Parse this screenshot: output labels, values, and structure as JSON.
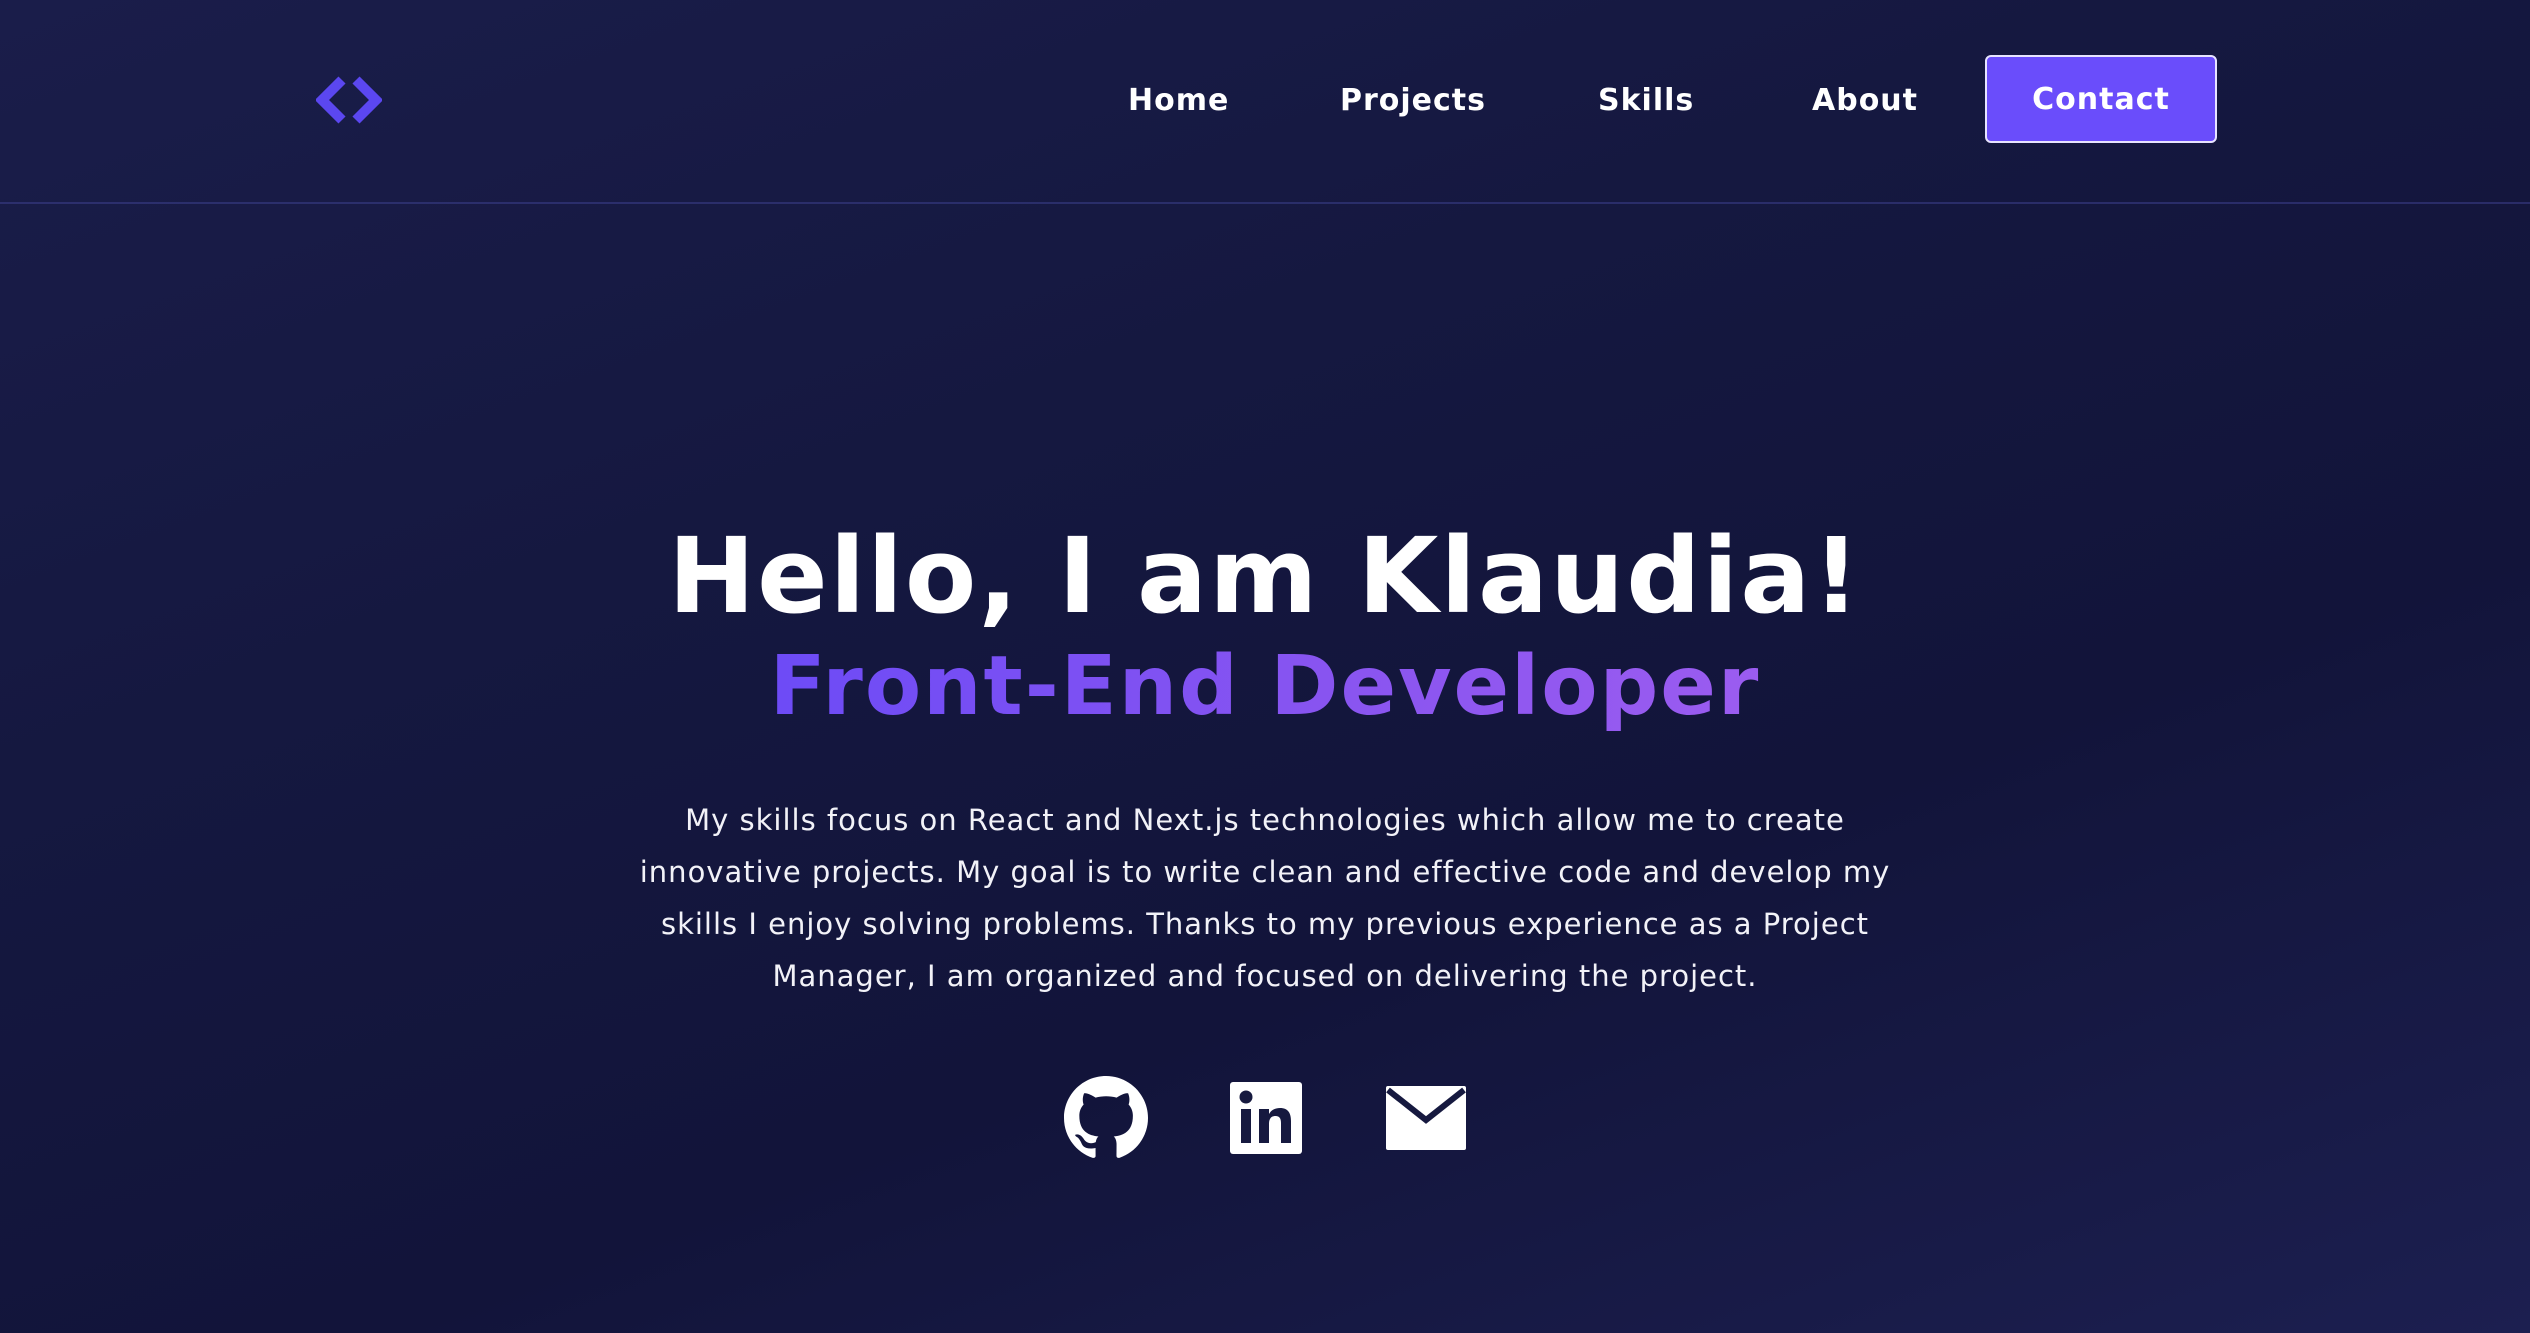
{
  "header": {
    "logo_icon": "code-brackets-icon",
    "logo_color": "#5b47f0",
    "nav": {
      "home": "Home",
      "projects": "Projects",
      "skills": "Skills",
      "about": "About"
    },
    "contact_label": "Contact",
    "accent_color": "#6a4dfb"
  },
  "hero": {
    "title": "Hello, I am Klaudia!",
    "subtitle": "Front-End Developer",
    "description": "My skills focus on React and Next.js technologies which allow me to create innovative projects. My goal is to write clean and effective code and develop my skills I enjoy solving problems. Thanks to my previous experience as a Project Manager, I am organized and focused on delivering the project."
  },
  "socials": [
    {
      "icon": "github-icon"
    },
    {
      "icon": "linkedin-icon"
    },
    {
      "icon": "mail-icon"
    }
  ]
}
